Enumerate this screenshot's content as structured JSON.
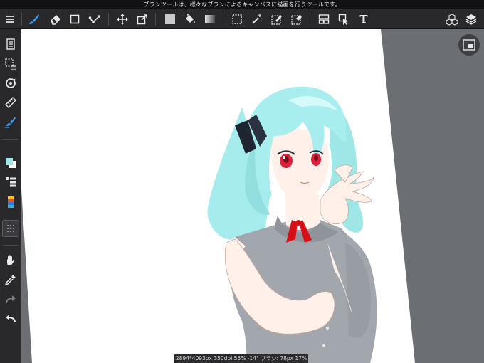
{
  "status": {
    "message": "ブラシツールは、様々なブラシによるキャンバスに描画を行うツールです。"
  },
  "toolbar": {
    "tools": [
      {
        "id": "menu",
        "icon": "hamburger-menu-icon"
      },
      {
        "id": "brush",
        "icon": "brush-icon",
        "active": true
      },
      {
        "id": "eraser",
        "icon": "eraser-icon"
      },
      {
        "id": "shape",
        "icon": "rectangle-shape-icon"
      },
      {
        "id": "edit",
        "icon": "vector-edit-icon"
      },
      {
        "id": "move",
        "icon": "move-arrows-icon"
      },
      {
        "id": "transform",
        "icon": "transform-icon"
      },
      {
        "id": "fill-rect",
        "icon": "fill-rectangle-icon"
      },
      {
        "id": "bucket",
        "icon": "paint-bucket-icon"
      },
      {
        "id": "gradient",
        "icon": "gradient-icon"
      },
      {
        "id": "select-rect",
        "icon": "rect-select-icon"
      },
      {
        "id": "magic-wand",
        "icon": "magic-wand-icon"
      },
      {
        "id": "select-pen",
        "icon": "select-pen-icon"
      },
      {
        "id": "select-eraser",
        "icon": "select-eraser-icon"
      },
      {
        "id": "frame-divider",
        "icon": "frame-divider-icon"
      },
      {
        "id": "operation",
        "icon": "operation-cursor-icon"
      },
      {
        "id": "text",
        "icon": "text-tool-icon",
        "label": "T"
      },
      {
        "id": "materials",
        "icon": "materials-cubes-icon"
      },
      {
        "id": "layers",
        "icon": "layers-icon"
      }
    ]
  },
  "sidebar": {
    "tools": [
      {
        "id": "pages",
        "icon": "pages-icon"
      },
      {
        "id": "selection-menu",
        "icon": "selection-menu-icon"
      },
      {
        "id": "rotate",
        "icon": "rotate-icon"
      },
      {
        "id": "ruler",
        "icon": "ruler-icon"
      },
      {
        "id": "brush-settings",
        "icon": "brush-settings-icon"
      },
      {
        "id": "color",
        "icon": "color-swatch-icon"
      },
      {
        "id": "layer-list",
        "icon": "layer-list-icon"
      },
      {
        "id": "palette",
        "icon": "color-palette-icon"
      },
      {
        "id": "grid",
        "icon": "grid-dots-icon"
      },
      {
        "id": "hand",
        "icon": "hand-icon"
      },
      {
        "id": "eyedropper",
        "icon": "eyedropper-icon"
      },
      {
        "id": "redo",
        "icon": "redo-icon"
      },
      {
        "id": "undo",
        "icon": "undo-icon"
      }
    ]
  },
  "canvas": {
    "image": "anime-girl-illustration",
    "hair_color": "#9fe6e6",
    "dress_color": "#a2a6ad",
    "ribbon_color": "#d60f17",
    "eye_color": "#e0203a",
    "skin_color": "#fff1ea",
    "background_color": "#6b6e72"
  },
  "info": {
    "text": "2894*4093px 350dpi 55% -14° ブラシ: 78px 17%"
  },
  "colors": {
    "accent": "#3a9be8",
    "toolbar_bg": "#29292c"
  }
}
